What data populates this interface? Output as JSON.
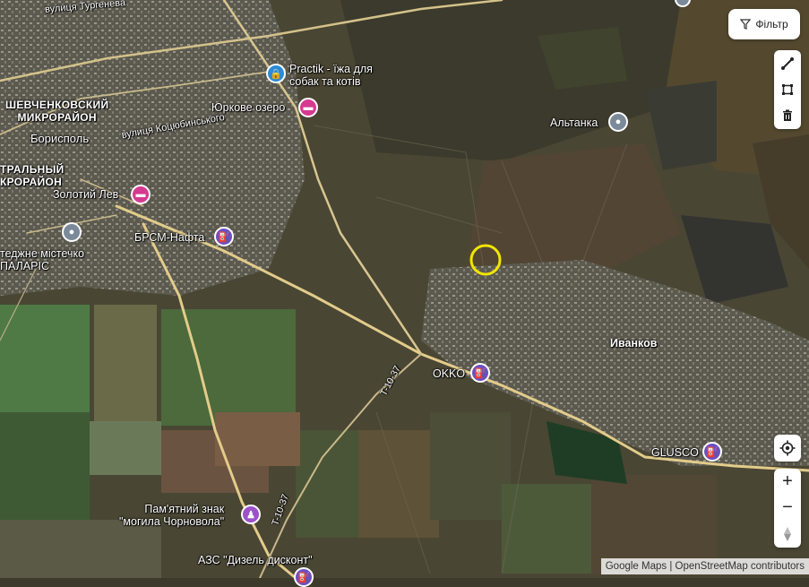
{
  "map": {
    "streets": {
      "turgeneva": "вулиця Тургенева",
      "kotsiubynskoho": "вулиця Коцюбинського",
      "t1037_a": "T-10-37",
      "t1037_b": "T-10-37"
    },
    "places": {
      "shevchenko": "ШЕВЧЕНКОВСКИЙ\nМИКРОРАЙОН",
      "boryspil": "Борисполь",
      "central": "ТРАЛЬНЫЙ\nКРОРАЙОН",
      "ivankov": "Иванков",
      "palaris": "теджне містечко\nПАЛАРІС"
    },
    "pois": [
      {
        "id": "practik",
        "label": "Practik - їжа для\nсобак та котів",
        "icon": "shopping-bag-icon",
        "color": "#2c8ad6"
      },
      {
        "id": "yurkove",
        "label": "Юркове озеро",
        "icon": "hotel-bed-icon",
        "color": "#d63a8f"
      },
      {
        "id": "zolotyi_lev",
        "label": "Золотий Лев",
        "icon": "hotel-bed-icon",
        "color": "#d63a8f"
      },
      {
        "id": "brsm",
        "label": "БРСМ-Нафта",
        "icon": "gas-station-icon",
        "color": "#6b4fc4"
      },
      {
        "id": "okko",
        "label": "OKKO",
        "icon": "gas-station-icon",
        "color": "#6b4fc4"
      },
      {
        "id": "glusco",
        "label": "GLUSCO",
        "icon": "gas-station-icon",
        "color": "#6b4fc4"
      },
      {
        "id": "altanka",
        "label": "Альтанка",
        "icon": "place-pin-icon",
        "color": "#7a8a99"
      },
      {
        "id": "memorial",
        "label": "Пам'ятний знак\n\"могила Чорновола\"",
        "icon": "monument-icon",
        "color": "#9b52c9"
      },
      {
        "id": "azs",
        "label": "АЗС \"Дизель дисконт\"",
        "icon": "gas-station-icon",
        "color": "#6b4fc4"
      }
    ],
    "marker": {
      "shape": "circle",
      "color": "#f2e600"
    }
  },
  "controls": {
    "filter_label": "Фільтр",
    "filter_icon": "filter-funnel-icon",
    "draw_tools": [
      "draw-line-icon",
      "draw-polygon-icon",
      "trash-icon"
    ],
    "locate_icon": "crosshair-locate-icon",
    "zoom_in": "+",
    "zoom_out": "−",
    "compass_icon": "compass-icon"
  },
  "attribution": {
    "google": "Google Maps",
    "separator": " | ",
    "osm": "OpenStreetMap contributors"
  }
}
